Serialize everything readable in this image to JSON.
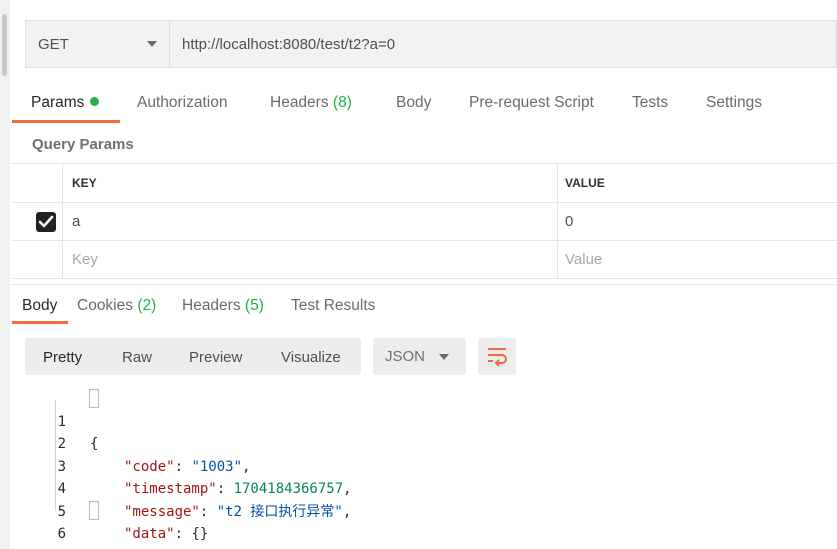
{
  "request": {
    "method": "GET",
    "url": "http://localhost:8080/test/t2?a=0"
  },
  "request_tabs": {
    "params": "Params",
    "authorization": "Authorization",
    "headers": "Headers",
    "headers_count": "(8)",
    "body": "Body",
    "prerequest": "Pre-request Script",
    "tests": "Tests",
    "settings": "Settings"
  },
  "query_params": {
    "title": "Query Params",
    "columns": {
      "key": "KEY",
      "value": "VALUE"
    },
    "rows": [
      {
        "checked": true,
        "key": "a",
        "value": "0"
      }
    ],
    "placeholder": {
      "key": "Key",
      "value": "Value"
    }
  },
  "response_tabs": {
    "body": "Body",
    "cookies": "Cookies",
    "cookies_count": "(2)",
    "headers": "Headers",
    "headers_count": "(5)",
    "test_results": "Test Results"
  },
  "response_view": {
    "modes": [
      "Pretty",
      "Raw",
      "Preview",
      "Visualize"
    ],
    "selected": "Pretty",
    "format": "JSON"
  },
  "response_body": {
    "line_numbers": [
      "1",
      "2",
      "3",
      "4",
      "5",
      "6"
    ],
    "open_brace": "{",
    "close_brace": "}",
    "fields": [
      {
        "key": "\"code\"",
        "sep": ": ",
        "value": "\"1003\"",
        "type": "str",
        "trail": ","
      },
      {
        "key": "\"timestamp\"",
        "sep": ": ",
        "value": "1704184366757",
        "type": "num",
        "trail": ","
      },
      {
        "key": "\"message\"",
        "sep": ": ",
        "value": "\"t2 接口执行异常\"",
        "type": "str",
        "trail": ","
      },
      {
        "key": "\"data\"",
        "sep": ": ",
        "value": "{}",
        "type": "punc",
        "trail": ""
      }
    ]
  }
}
